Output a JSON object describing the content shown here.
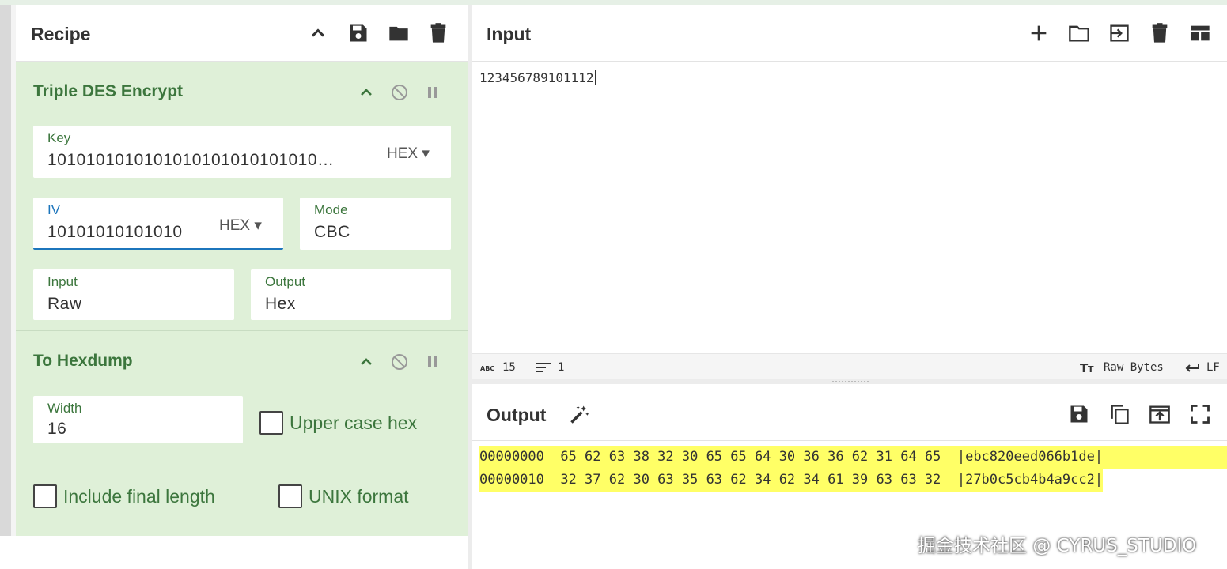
{
  "recipe": {
    "title": "Recipe",
    "icons": [
      "chevron-up-icon",
      "save-icon",
      "folder-icon",
      "trash-icon"
    ],
    "operations": [
      {
        "title": "Triple DES Encrypt",
        "key": {
          "label": "Key",
          "value": "1010101010101010101010101010…",
          "format": "HEX"
        },
        "iv": {
          "label": "IV",
          "value": "10101010101010",
          "format": "HEX"
        },
        "mode": {
          "label": "Mode",
          "value": "CBC"
        },
        "input": {
          "label": "Input",
          "value": "Raw"
        },
        "output": {
          "label": "Output",
          "value": "Hex"
        }
      },
      {
        "title": "To Hexdump",
        "width": {
          "label": "Width",
          "value": "16"
        },
        "upper_case_hex": "Upper case hex",
        "include_final_length": "Include final length",
        "unix_format": "UNIX format"
      }
    ]
  },
  "input": {
    "title": "Input",
    "text": "123456789101112",
    "status": {
      "length": "15",
      "lines": "1",
      "encoding": "Raw Bytes",
      "eol": "LF"
    }
  },
  "output": {
    "title": "Output",
    "lines": [
      "00000000  65 62 63 38 32 30 65 65 64 30 36 36 62 31 64 65  |ebc820eed066b1de|",
      "00000010  32 37 62 30 63 35 63 62 34 62 34 61 39 63 63 32  |27b0c5cb4b4a9cc2|"
    ]
  },
  "watermark": "掘金技术社区 @ CYRUS_STUDIO",
  "colors": {
    "op_bg": "#dff0d8",
    "op_title": "#3c763d",
    "highlight": "#ffff66",
    "active_field": "#1c75bc"
  }
}
